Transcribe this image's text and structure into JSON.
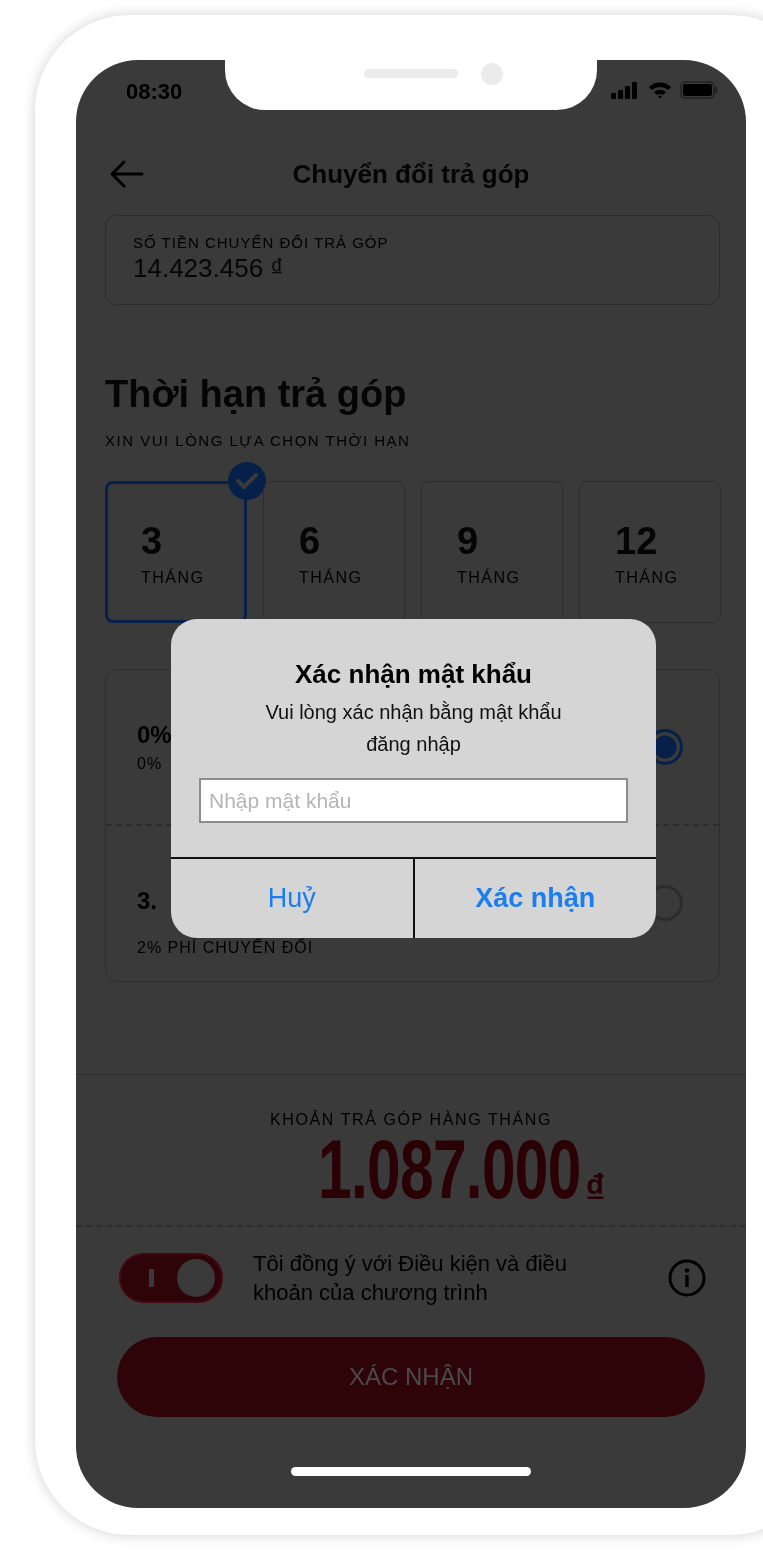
{
  "status_bar": {
    "time": "08:30"
  },
  "header": {
    "title": "Chuyển đổi trả góp"
  },
  "amount": {
    "label": "SỐ TIỀN CHUYỂN ĐỔI TRẢ GÓP",
    "value": "14.423.456 ₫"
  },
  "term_section": {
    "title": "Thời hạn trả góp",
    "subtitle": "XIN VUI LÒNG LỰA CHỌN THỜI HẠN",
    "options": [
      {
        "value": "3",
        "unit": "THÁNG",
        "selected": true
      },
      {
        "value": "6",
        "unit": "THÁNG",
        "selected": false
      },
      {
        "value": "9",
        "unit": "THÁNG",
        "selected": false
      },
      {
        "value": "12",
        "unit": "THÁNG",
        "selected": false
      }
    ]
  },
  "plans": [
    {
      "title": "0%",
      "note": "0%",
      "selected": true
    },
    {
      "title": "3.",
      "note": "2% PHÍ CHUYỂN ĐỔI",
      "selected": false
    }
  ],
  "monthly": {
    "label": "KHOẢN TRẢ GÓP HÀNG THÁNG",
    "amount": "1.087.000",
    "currency": "₫"
  },
  "agreement": {
    "on": true,
    "text": "Tôi đồng ý với Điều kiện và điều khoản của chương trình"
  },
  "submit_button": "XÁC NHẬN",
  "dialog": {
    "title": "Xác nhận mật khẩu",
    "message": "Vui lòng xác nhận bằng mật khẩu đăng nhập",
    "placeholder": "Nhập mật khẩu",
    "buttons": [
      {
        "label": "Huỷ",
        "kind": "cancel"
      },
      {
        "label": "Xác nhận",
        "kind": "confirm"
      }
    ]
  }
}
